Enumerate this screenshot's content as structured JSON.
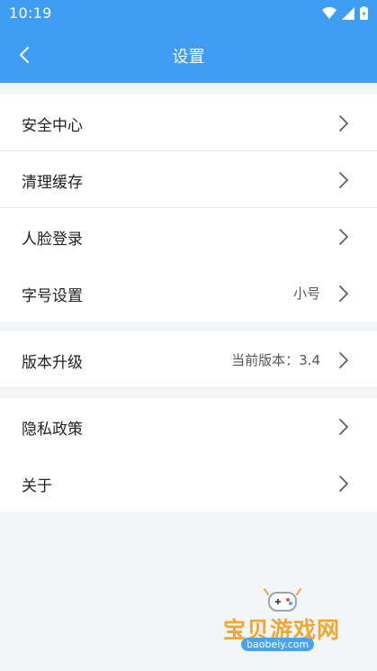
{
  "status_bar": {
    "time": "10:19"
  },
  "header": {
    "title": "设置"
  },
  "groups": [
    [
      {
        "label": "安全中心"
      },
      {
        "label": "清理缓存"
      },
      {
        "label": "人脸登录"
      },
      {
        "label": "字号设置",
        "value": "小号"
      }
    ],
    [
      {
        "label": "版本升级",
        "value": "当前版本：3.4"
      }
    ],
    [
      {
        "label": "隐私政策"
      },
      {
        "label": "关于"
      }
    ]
  ],
  "watermark": {
    "text": "宝贝游戏网",
    "url": "baobeiy.com"
  },
  "colors": {
    "accent": "#3f9df3",
    "background": "#f3f6f8",
    "watermark": "#f0a732"
  }
}
